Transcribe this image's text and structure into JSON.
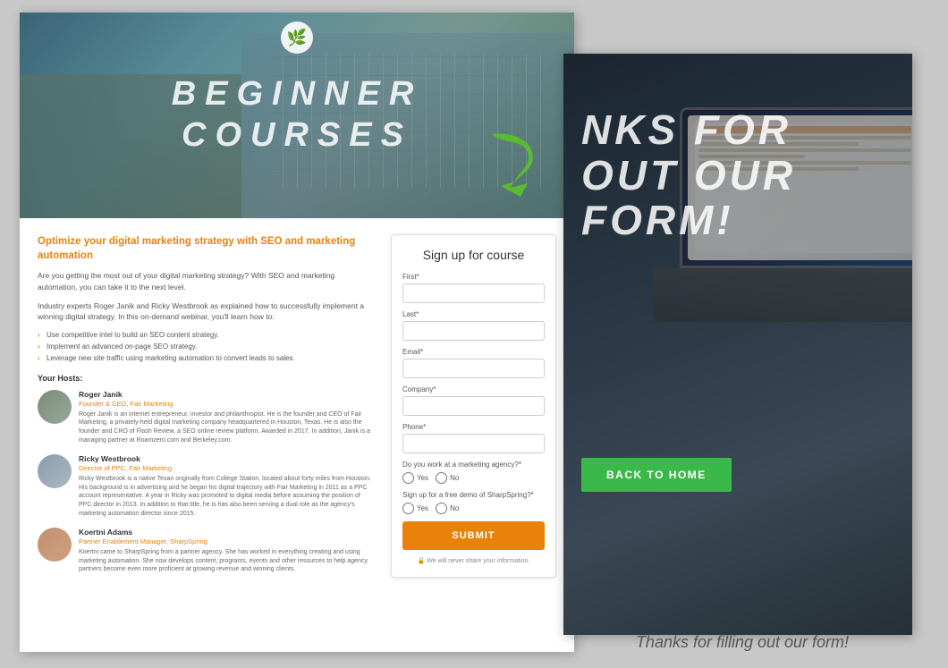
{
  "page": {
    "bg_color": "#c8c8c8"
  },
  "left_page": {
    "hero": {
      "title_line1": "BEGINNER",
      "title_line2": "COURSES"
    },
    "content": {
      "section_title": "Optimize your digital marketing strategy with SEO and marketing automation",
      "intro_text": "Are you getting the most out of your digital marketing strategy? With SEO and marketing automation, you can take it to the next level.",
      "body_text": "Industry experts Roger Janik and Ricky Westbrook as explained how to successfully implement a winning digital strategy. In this on-demand webinar, you'll learn how to:",
      "bullet_1": "Use competitive intel to build an SEO content strategy.",
      "bullet_2": "Implement an advanced on-page SEO strategy.",
      "bullet_3": "Leverage new site traffic using marketing automation to convert leads to sales.",
      "hosts_label": "Your Hosts:"
    },
    "hosts": [
      {
        "name": "Roger Janik",
        "role": "Founder & CEO, Fair Marketing",
        "desc": "Roger Janik is an internet entrepreneur, investor and philanthropist. He is the founder and CEO of Fair Marketing, a privately-held digital marketing company headquartered in Houston, Texas. He is also the founder and CRO of Flash Review, a SEO online review platform. Awarded in 2017. In addition, Janik is a managing partner at Roamzero.com and Berkeley.com."
      },
      {
        "name": "Ricky Westbrook",
        "role": "Director of PPC, Fair Marketing",
        "desc": "Ricky Westbrook is a native Texan originally from College Station, located about forty miles from Houston. His background is in advertising and he began his digital trajectory with Fair Marketing in 2011 as a PPC account representative. A year in Ricky was promoted to digital media before assuming the position of PPC director in 2013. In addition to that title, he is has also been serving a dual role as the agency's marketing automation director since 2015."
      },
      {
        "name": "Koertni Adams",
        "role": "Partner Enablement Manager, SharpSpring",
        "desc": "Koertni came to SharpSpring from a partner agency. She has worked in everything creating and using marketing automation. She now develops content, programs, events and other resources to help agency partners become even more proficient at growing revenue and winning clients."
      }
    ],
    "form": {
      "title": "Sign up for course",
      "first_label": "First*",
      "last_label": "Last*",
      "email_label": "Email*",
      "company_label": "Company*",
      "phone_label": "Phone*",
      "marketing_agency_label": "Do you work at a marketing agency?*",
      "sharpspring_demo_label": "Sign up for a free demo of SharpSpring?*",
      "yes_label": "Yes",
      "no_label": "No",
      "submit_label": "SUBMIT",
      "privacy_note": "🔒 We will never share your information."
    }
  },
  "right_page": {
    "thankyou_line1": "NKS FOR",
    "thankyou_line2": "OUT OUR",
    "thankyou_line3": "FORM!",
    "back_button_label": "BACK TO HOME",
    "bottom_text": "Thanks for filling out our form!"
  },
  "arrow": {
    "color": "#5aba30"
  }
}
